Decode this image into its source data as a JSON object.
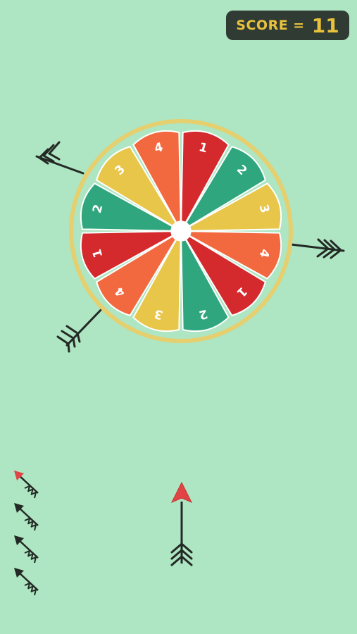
{
  "score": {
    "label": "SCORE =",
    "value": "11"
  },
  "wheel": {
    "segments": [
      {
        "label": "1",
        "color": "#d42a2e"
      },
      {
        "label": "2",
        "color": "#2fa67e"
      },
      {
        "label": "3",
        "color": "#e8c64a"
      },
      {
        "label": "4",
        "color": "#f26940"
      },
      {
        "label": "1",
        "color": "#d42a2e"
      },
      {
        "label": "2",
        "color": "#2fa67e"
      },
      {
        "label": "3",
        "color": "#e8c64a"
      },
      {
        "label": "4",
        "color": "#f26940"
      },
      {
        "label": "1",
        "color": "#d42a2e"
      },
      {
        "label": "2",
        "color": "#2fa67e"
      },
      {
        "label": "3",
        "color": "#e8c64a"
      },
      {
        "label": "4",
        "color": "#f26940"
      }
    ],
    "rim_color": "#e5cf6f"
  },
  "arrows_remaining": {
    "count": 4,
    "next_tip_color": "#e04444",
    "tip_color": "#232a25"
  },
  "colors": {
    "background": "#aee5c2",
    "shaft": "#232a25",
    "active_tip": "#e04444"
  }
}
